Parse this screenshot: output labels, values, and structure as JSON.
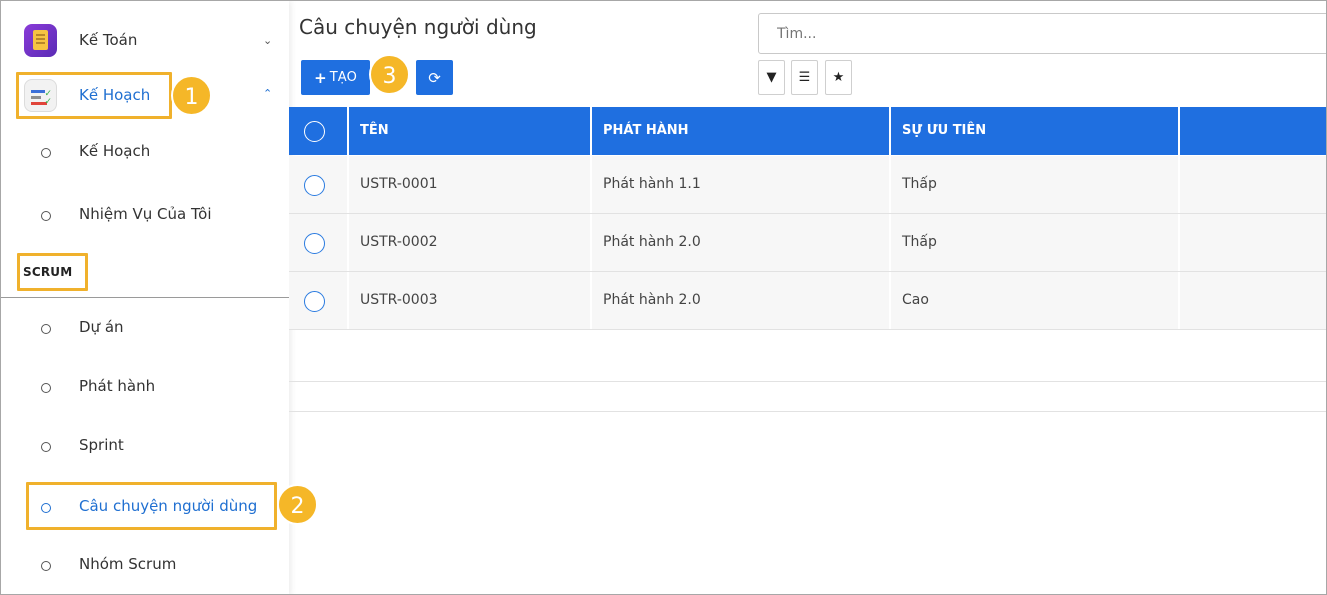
{
  "sidebar": {
    "apps": [
      {
        "label": "Kế Toán",
        "icon": "accounting-app-icon",
        "chevron": "chevron-down-icon"
      },
      {
        "label": "Kế Hoạch",
        "icon": "planning-app-icon",
        "chevron": "chevron-up-icon"
      }
    ],
    "plan_items": [
      {
        "label": "Kế Hoạch"
      },
      {
        "label": "Nhiệm Vụ Của Tôi"
      }
    ],
    "section": "SCRUM",
    "scrum_items": [
      {
        "label": "Dự án"
      },
      {
        "label": "Phát hành"
      },
      {
        "label": "Sprint"
      },
      {
        "label": "Câu chuyện người dùng"
      },
      {
        "label": "Nhóm Scrum"
      }
    ]
  },
  "annotations": {
    "step1": "1",
    "step2": "2",
    "step3": "3"
  },
  "main": {
    "title": "Câu chuyện người dùng",
    "search_placeholder": "Tìm...",
    "create_label": "TẠO",
    "table": {
      "headers": [
        "TÊN",
        "PHÁT HÀNH",
        "SỰ ƯU TIÊN"
      ],
      "rows": [
        {
          "name": "USTR-0001",
          "release": "Phát hành 1.1",
          "priority": "Thấp"
        },
        {
          "name": "USTR-0002",
          "release": "Phát hành 2.0",
          "priority": "Thấp"
        },
        {
          "name": "USTR-0003",
          "release": "Phát hành 2.0",
          "priority": "Cao"
        }
      ]
    }
  },
  "colors": {
    "accent": "#1f6fe0",
    "highlight": "#f0b12c",
    "badge": "#f5b728",
    "active_text": "#1f6fd1"
  }
}
